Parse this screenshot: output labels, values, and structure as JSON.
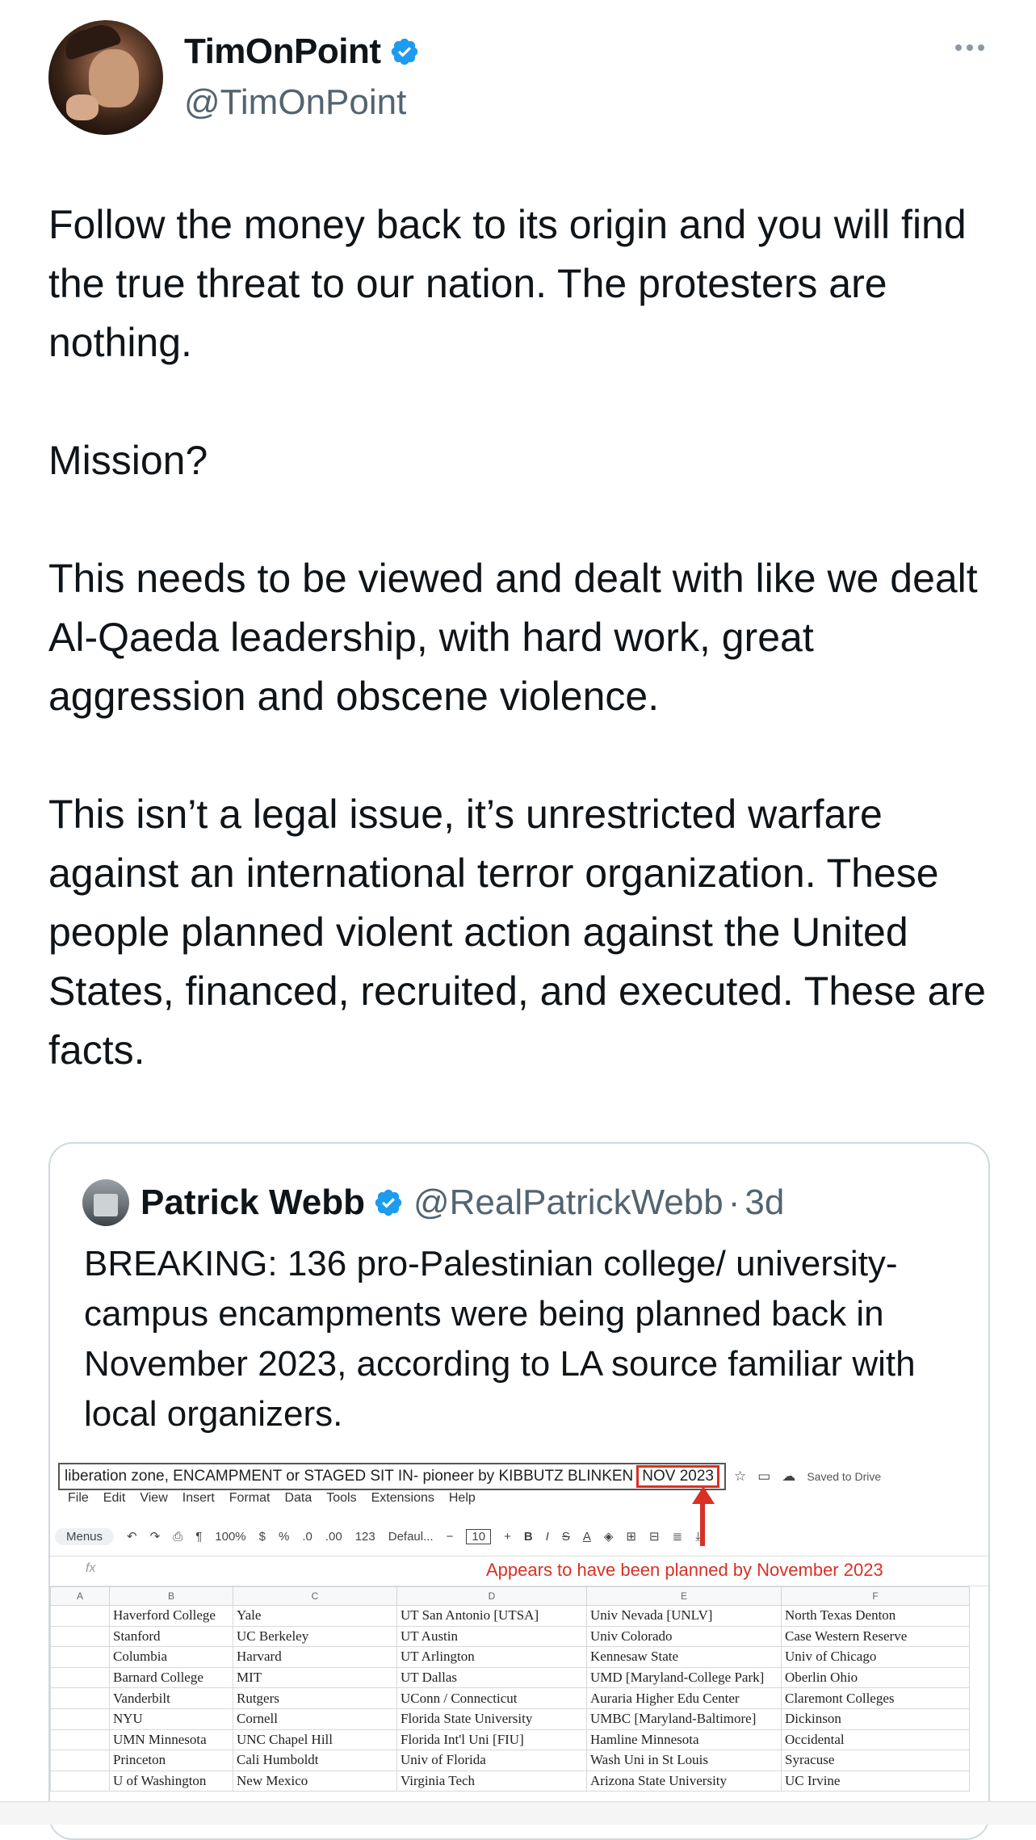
{
  "author": {
    "name": "TimOnPoint",
    "handle": "@TimOnPoint"
  },
  "tweet": {
    "paragraphs": [
      "Follow the money back to its origin and you will find the true threat to our nation. The protesters are nothing.",
      "Mission?",
      "This needs to be viewed and dealt with like we dealt Al-Qaeda leadership, with hard work, great aggression and obscene violence.",
      "This isn’t a legal issue, it’s unrestricted warfare against an international terror organization. These people planned violent action against the United States, financed, recruited, and executed. These are facts."
    ]
  },
  "quote": {
    "name": "Patrick Webb",
    "handle": "@RealPatrickWebb",
    "separator": "·",
    "time": "3d",
    "text": "BREAKING: 136 pro-Palestinian college/ university-campus encampments were being planned back in November 2023, according to LA source familiar with local organizers."
  },
  "spreadsheet": {
    "title": "liberation zone, ENCAMPMENT or STAGED SIT IN- pioneer by KIBBUTZ BLINKEN",
    "highlight": "NOV 2023",
    "saved": "Saved to Drive",
    "menus": [
      "File",
      "Edit",
      "View",
      "Insert",
      "Format",
      "Data",
      "Tools",
      "Extensions",
      "Help"
    ],
    "toolbar": {
      "menus": "Menus",
      "zoom": "100%",
      "currency": "$",
      "percent": "%",
      "dec_less": ".0",
      "dec_more": ".00",
      "number": "123",
      "font": "Defaul...",
      "font_size": "10",
      "minus": "−",
      "plus": "+",
      "bold": "B",
      "italic": "I",
      "strike": "S",
      "text_color": "A"
    },
    "fx": "fx",
    "annotation": "Appears to have been planned by November 2023",
    "columns": [
      "A",
      "B",
      "C",
      "D",
      "E",
      "F"
    ],
    "rows": [
      [
        "",
        "Haverford College",
        "Yale",
        "UT San Antonio [UTSA]",
        "Univ Nevada [UNLV]",
        "North Texas Denton"
      ],
      [
        "",
        "Stanford",
        "UC Berkeley",
        "UT Austin",
        "Univ Colorado",
        "Case Western Reserve"
      ],
      [
        "",
        "Columbia",
        "Harvard",
        "UT Arlington",
        "Kennesaw State",
        "Univ of Chicago"
      ],
      [
        "",
        "Barnard College",
        "MIT",
        "UT Dallas",
        "UMD [Maryland-College Park]",
        "Oberlin Ohio"
      ],
      [
        "",
        "Vanderbilt",
        "Rutgers",
        "UConn / Connecticut",
        "Auraria Higher Edu Center",
        "Claremont Colleges"
      ],
      [
        "",
        "NYU",
        "Cornell",
        "Florida State University",
        "UMBC [Maryland-Baltimore]",
        "Dickinson"
      ],
      [
        "",
        "UMN Minnesota",
        "UNC Chapel Hill",
        "Florida Int'l Uni [FIU]",
        "Hamline Minnesota",
        "Occidental"
      ],
      [
        "",
        "Princeton",
        "Cali Humboldt",
        "Univ of Florida",
        "Wash Uni in St Louis",
        "Syracuse"
      ],
      [
        "",
        "U of Washington",
        "New Mexico",
        "Virginia Tech",
        "Arizona State University",
        "UC Irvine"
      ]
    ]
  },
  "colors": {
    "verified": "#1d9bf0",
    "annotation": "#d93025",
    "secondary_text": "#536471"
  }
}
